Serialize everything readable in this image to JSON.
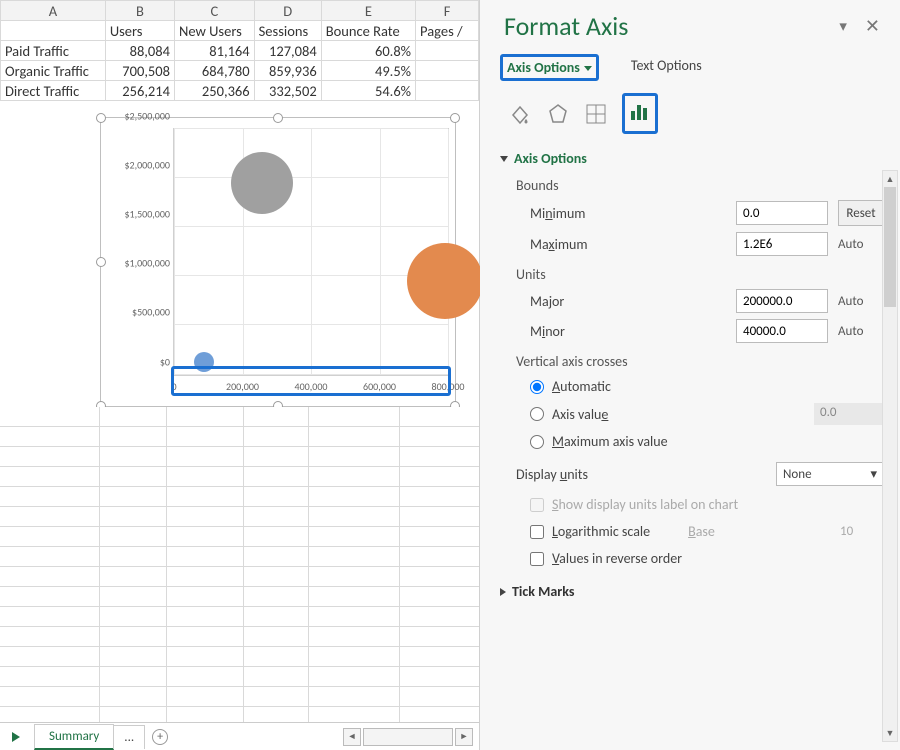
{
  "columns": [
    "A",
    "B",
    "C",
    "D",
    "E",
    "F"
  ],
  "header_row": {
    "B": "Users",
    "C": "New Users",
    "D": "Sessions",
    "E": "Bounce Rate",
    "F": "Pages /"
  },
  "rows": [
    {
      "label": "Paid Traffic",
      "users": "88,084",
      "newUsers": "81,164",
      "sessions": "127,084",
      "bounce": "60.8%"
    },
    {
      "label": "Organic Traffic",
      "users": "700,508",
      "newUsers": "684,780",
      "sessions": "859,936",
      "bounce": "49.5%"
    },
    {
      "label": "Direct Traffic",
      "users": "256,214",
      "newUsers": "250,366",
      "sessions": "332,502",
      "bounce": "54.6%"
    }
  ],
  "chart_data": {
    "type": "scatter",
    "subtype": "bubble",
    "title": "",
    "xlabel": "",
    "ylabel": "",
    "xlim": [
      0,
      800000
    ],
    "ylim": [
      0,
      2500000
    ],
    "xticks": [
      "0",
      "200,000",
      "400,000",
      "600,000",
      "800,000"
    ],
    "yticks": [
      "$0",
      "$500,000",
      "$1,000,000",
      "$1,500,000",
      "$2,000,000",
      "$2,500,000"
    ],
    "series": [
      {
        "name": "Paid Traffic",
        "x": 88084,
        "y": 130000,
        "size": 20,
        "color": "#6f9ed8"
      },
      {
        "name": "Organic Traffic",
        "x": 700508,
        "y": 960000,
        "size": 70,
        "color": "#e38a4e"
      },
      {
        "name": "Direct Traffic",
        "x": 256214,
        "y": 1950000,
        "size": 60,
        "color": "#a0a0a0"
      }
    ]
  },
  "tabbar": {
    "active": "Summary",
    "dots": "...",
    "add": "+"
  },
  "pane": {
    "title": "Format Axis",
    "tabs": {
      "axis": "Axis Options",
      "text": "Text Options"
    },
    "sectionTitle": "Axis Options",
    "bounds": {
      "head": "Bounds",
      "minLbl": "Minimum",
      "min": "0.0",
      "reset": "Reset",
      "maxLbl": "Maximum",
      "max": "1.2E6",
      "auto": "Auto"
    },
    "units": {
      "head": "Units",
      "majorLbl": "Major",
      "major": "200000.0",
      "minorLbl": "Minor",
      "minor": "40000.0",
      "auto": "Auto"
    },
    "cross": {
      "head": "Vertical axis crosses",
      "auto": "Automatic",
      "axisVal": "Axis value",
      "axisValNum": "0.0",
      "maxVal": "Maximum axis value"
    },
    "display": {
      "lbl": "Display units",
      "value": "None",
      "showLabel": "Show display units label on chart"
    },
    "log": {
      "lbl": "Logarithmic scale",
      "baseLbl": "Base",
      "base": "10"
    },
    "reverse": "Values in reverse order",
    "tickMarks": "Tick Marks"
  }
}
